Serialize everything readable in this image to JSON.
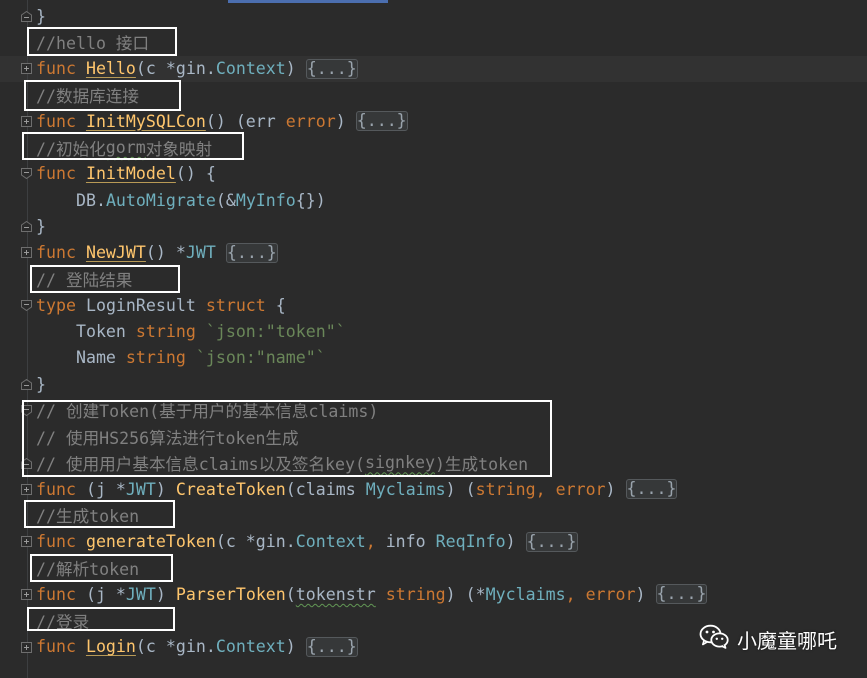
{
  "editor": {
    "lines": [
      [
        "}"
      ],
      [
        "//hello 接口"
      ],
      [
        "func ",
        "Hello",
        "(c *gin.",
        "Context",
        ") ",
        "{...}"
      ],
      [
        "//数据库连接"
      ],
      [
        "func ",
        "InitMySQLCon",
        "() (err ",
        "error",
        ") ",
        "{...}"
      ],
      [
        "//初始化",
        "gorm",
        "对象映射"
      ],
      [
        "func ",
        "InitModel",
        "() {"
      ],
      [
        "    DB.",
        "AutoMigrate",
        "(&",
        "MyInfo",
        "{})"
      ],
      [
        "}"
      ],
      [
        "func ",
        "NewJWT",
        "() *",
        "JWT ",
        "{...}"
      ],
      [
        "// 登陆结果"
      ],
      [
        "type",
        " LoginResult ",
        "struct",
        " {"
      ],
      [
        "    Token ",
        "string",
        " `json:\"token\"`"
      ],
      [
        "    Name ",
        "string",
        " `json:\"name\"`"
      ],
      [
        "}"
      ],
      [
        "// 创建Token(基于用户的基本信息claims)"
      ],
      [
        "// 使用HS256算法进行token生成"
      ],
      [
        "// 使用用户基本信息claims以及签名key(",
        "signkey",
        ")生成token"
      ],
      [
        "func",
        " (j *",
        "JWT",
        ") ",
        "CreateToken",
        "(claims ",
        "Myclaims",
        ") (",
        "string",
        ", ",
        "error",
        ") ",
        "{...}"
      ],
      [
        "//生成token"
      ],
      [
        "func ",
        "generateToken",
        "(c *gin.",
        "Context",
        ",",
        " info ",
        "ReqInfo",
        ") ",
        "{...}"
      ],
      [
        "//解析token"
      ],
      [
        "func",
        " (j *",
        "JWT",
        ") ",
        "ParserToken",
        "(",
        "tokenstr",
        " string",
        ") (*",
        "Myclaims",
        ", ",
        "error",
        ") ",
        "{...}"
      ],
      [
        "//登录"
      ],
      [
        "func ",
        "Login",
        "(c *gin.",
        "Context",
        ") ",
        "{...}"
      ]
    ]
  },
  "watermark": {
    "icon": "wechat-icon",
    "text": "小魔童哪吒"
  },
  "colors": {
    "background": "#2b2b2b",
    "keyword": "#cc7832",
    "function": "#ffc66d",
    "type": "#6fafbd",
    "comment": "#808080",
    "string": "#6a8759",
    "text": "#a9b7c6",
    "annotation_box": "#ffffff"
  }
}
